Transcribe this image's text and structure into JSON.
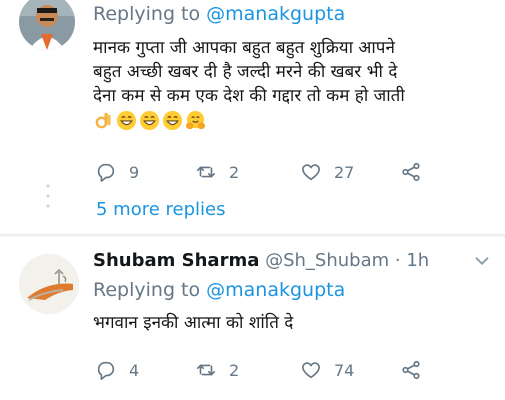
{
  "colors": {
    "link": "#1b95e0",
    "muted": "#657786",
    "text": "#14171a"
  },
  "tweet1": {
    "replying_prefix": "Replying to ",
    "replying_mention": "@manakgupta",
    "text_lines": [
      "मानक गुप्ता जी आपका बहुत बहुत शुक्रिया आपने",
      "बहुत अच्छी खबर दी है जल्दी मरने की खबर भी दे",
      "देना  कम से कम एक देश की गद्दार तो कम हो जाती"
    ],
    "emojis": [
      "ok-hand-emoji",
      "grinning-emoji",
      "grinning-emoji",
      "grinning-emoji",
      "hugging-emoji"
    ],
    "reply_count": "9",
    "retweet_count": "2",
    "like_count": "27"
  },
  "more_replies": "5 more replies",
  "tweet2": {
    "display_name": "Shubam Sharma",
    "handle": "@Sh_Shubam",
    "separator": " · ",
    "time": "1h",
    "replying_prefix": "Replying to ",
    "replying_mention": "@manakgupta",
    "text": "भगवान इनकी आत्मा को शांति दे",
    "reply_count": "4",
    "retweet_count": "2",
    "like_count": "74"
  }
}
